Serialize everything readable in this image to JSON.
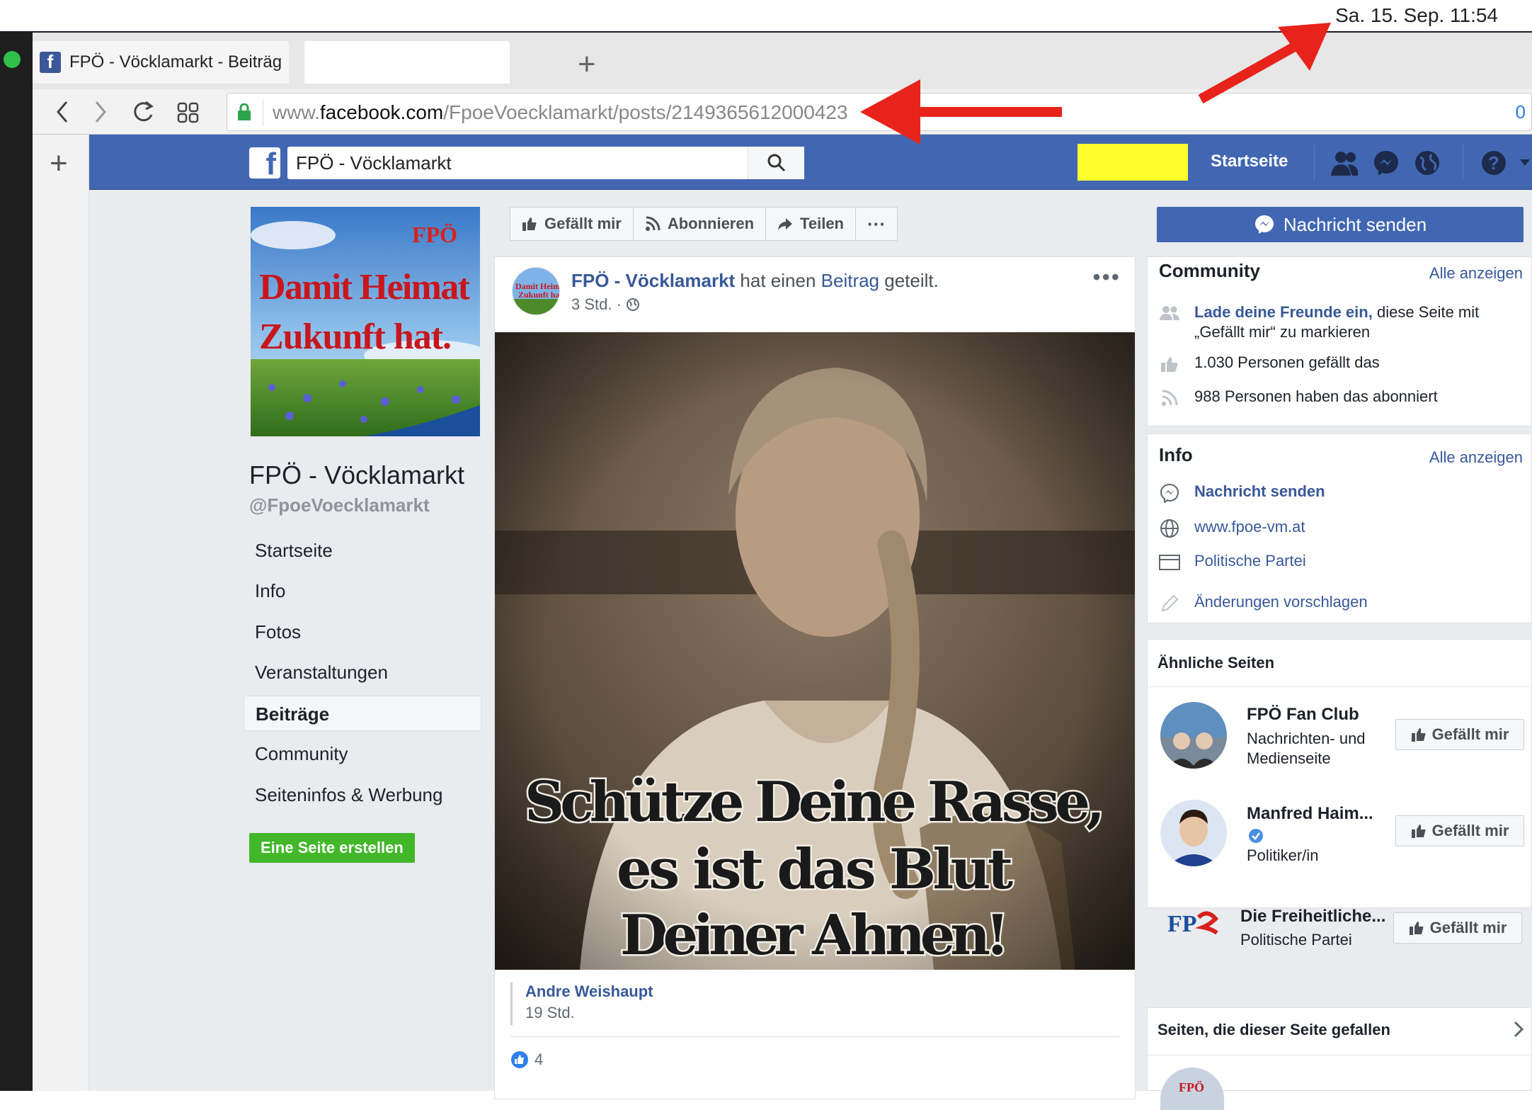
{
  "menubar": {
    "clock": "Sa. 15. Sep.  11:54"
  },
  "browser": {
    "tabs": [
      {
        "title": "FPÖ - Vöcklamarkt - Beiträge"
      },
      {
        "title": ""
      }
    ],
    "url_domain": "www.facebook.com",
    "url_path": "/FpoeVoecklamarkt/posts/2149365612000423",
    "url_prefix": "www.",
    "url_host": "facebook.com",
    "right_indicator": "0"
  },
  "header": {
    "search_value": "FPÖ - Vöcklamarkt",
    "home_label": "Startseite"
  },
  "page": {
    "cover_line1": "Damit Heimat",
    "cover_line2": "Zukunft hat.",
    "cover_logo": "FPÖ",
    "name": "FPÖ - Vöcklamarkt",
    "handle": "@FpoeVoecklamarkt",
    "nav": [
      {
        "label": "Startseite",
        "active": false
      },
      {
        "label": "Info",
        "active": false
      },
      {
        "label": "Fotos",
        "active": false
      },
      {
        "label": "Veranstaltungen",
        "active": false
      },
      {
        "label": "Beiträge",
        "active": true
      },
      {
        "label": "Community",
        "active": false
      },
      {
        "label": "Seiteninfos & Werbung",
        "active": false
      }
    ],
    "create_page": "Eine Seite erstellen"
  },
  "actions": {
    "like": "Gefällt mir",
    "follow": "Abonnieren",
    "share": "Teilen",
    "more": "···",
    "send_message": "Nachricht senden"
  },
  "post": {
    "author": "FPÖ - Vöcklamarkt",
    "middle": " hat einen ",
    "object": "Beitrag",
    "end": " geteilt.",
    "time": "3 Std. · ",
    "more": "•••",
    "image_line1": "Schütze Deine Rasse,",
    "image_line2": "es ist das Blut",
    "image_line3": "Deiner Ahnen!",
    "shared_author": "Andre Weishaupt",
    "shared_time": "19 Std.",
    "like_count": "4"
  },
  "community": {
    "title": "Community",
    "see_all": "Alle anzeigen",
    "invite_link": "Lade deine Freunde ein,",
    "invite_rest": " diese Seite mit „Gefällt mir“ zu markieren",
    "likes": "1.030 Personen gefällt das",
    "follows": "988 Personen haben das abonniert"
  },
  "info": {
    "title": "Info",
    "see_all": "Alle anzeigen",
    "message": "Nachricht senden",
    "website": "www.fpoe-vm.at",
    "category": "Politische Partei",
    "suggest": "Änderungen vorschlagen"
  },
  "similar": {
    "title": "Ähnliche Seiten",
    "like_label": "Gefällt mir",
    "items": [
      {
        "name": "FPÖ Fan Club",
        "sub": "Nachrichten- und Medienseite"
      },
      {
        "name": "Manfred Haim...",
        "sub": "Politiker/in"
      },
      {
        "name": "Die Freiheitliche...",
        "sub": "Politische Partei"
      }
    ]
  },
  "liked_pages": {
    "title": "Seiten, die dieser Seite gefallen"
  },
  "colors": {
    "fb_blue": "#4267b2",
    "link": "#385898",
    "green": "#42b72a",
    "arrow_red": "#e8231b",
    "highlight": "#ffff2e"
  }
}
